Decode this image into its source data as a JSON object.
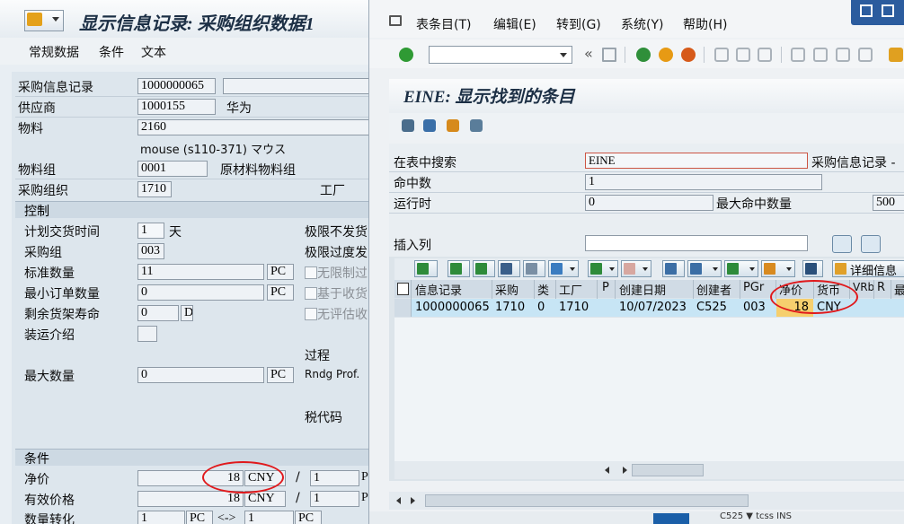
{
  "left_window": {
    "title": "显示信息记录: 采购组织数据1",
    "tabs": [
      "常规数据",
      "条件",
      "文本"
    ],
    "fields": {
      "info_record_label": "采购信息记录",
      "info_record_value": "1000000065",
      "vendor_label": "供应商",
      "vendor_value": "1000155",
      "vendor_name": "华为",
      "material_label": "物料",
      "material_value": "2160",
      "material_desc": "mouse (s110-371) マウス",
      "matl_group_label": "物料组",
      "matl_group_value": "0001",
      "matl_group_desc": "原材料物料组",
      "purch_org_label": "采购组织",
      "purch_org_value": "1710",
      "plant_label": "工厂"
    },
    "control": {
      "title": "控制",
      "plan_deliv_label": "计划交货时间",
      "plan_deliv_value": "1",
      "plan_deliv_unit": "天",
      "purch_group_label": "采购组",
      "purch_group_value": "003",
      "std_qty_label": "标准数量",
      "std_qty_value": "11",
      "std_qty_unit": "PC",
      "min_order_label": "最小订单数量",
      "min_order_value": "0",
      "min_order_unit": "PC",
      "shelf_life_label": "剩余货架寿命",
      "shelf_life_value": "0",
      "shelf_life_unit": "D",
      "shipping_label": "装运介绍",
      "max_qty_label": "最大数量",
      "max_qty_value": "0",
      "max_qty_unit": "PC",
      "underdeliv_label": "极限不发货",
      "overdeliv_label": "极限过度发",
      "unlimited_label": "无限制过",
      "gr_based_label": "基于收货",
      "no_eval_label": "无评估收",
      "procedure_label": "过程",
      "rndg_label": "Rndg Prof.",
      "tax_label": "税代码"
    },
    "conditions": {
      "title": "条件",
      "net_price_label": "净价",
      "net_price_value": "18",
      "net_price_currency": "CNY",
      "net_price_per": "1",
      "eff_price_label": "有效价格",
      "eff_price_value": "18",
      "eff_price_currency": "CNY",
      "eff_price_per": "1",
      "qty_conv_label": "数量转化",
      "qty_conv_value1": "1",
      "qty_conv_unit1": "PC",
      "qty_conv_arrow": "<->",
      "qty_conv_value2": "1",
      "qty_conv_unit2": "PC",
      "slash": "/",
      "per_unit_abbrev": "P"
    }
  },
  "right_window": {
    "menu": [
      "表条目(T)",
      "编辑(E)",
      "转到(G)",
      "系统(Y)",
      "帮助(H)"
    ],
    "page_title": "EINE: 显示找到的条目",
    "search_label": "在表中搜索",
    "search_value": "EINE",
    "search_desc": "采购信息记录 -",
    "hits_label": "命中数",
    "hits_value": "1",
    "runtime_label": "运行时",
    "runtime_value": "0",
    "max_hits_label": "最大命中数量",
    "max_hits_value": "500",
    "insert_col_label": "插入列",
    "detail_label": "详细信息",
    "columns": [
      "信息记录",
      "采购",
      "类",
      "工厂",
      "P",
      "创建日期",
      "创建者",
      "PGr",
      "净价",
      "货币",
      "VRb",
      "R",
      "最"
    ],
    "row": {
      "info_record": "1000000065",
      "purch_org": "1710",
      "category": "0",
      "plant": "1710",
      "created_on": "10/07/2023",
      "created_by": "C525",
      "pgr": "003",
      "net_price": "18",
      "currency": "CNY"
    },
    "status_fragment": "C525 ▼  tcss  INS"
  },
  "colors": {
    "highlight_red": "#e0191c",
    "selected_row": "#c7e5f5",
    "price_cell": "#f6cf6e",
    "title_blue": "#1c2f45"
  }
}
